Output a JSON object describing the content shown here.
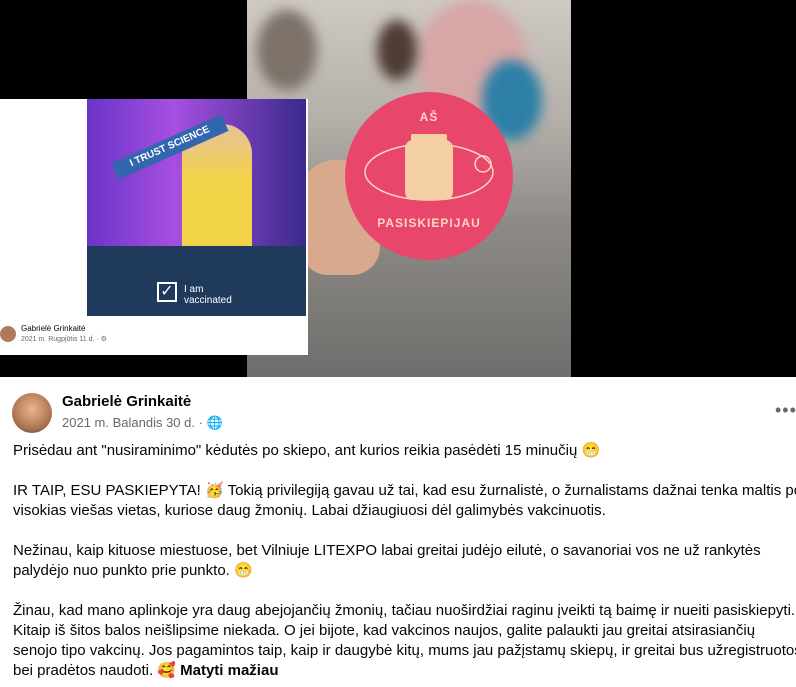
{
  "embed": {
    "banner_text": "I TRUST SCIENCE",
    "vaccinated_line1": "I am",
    "vaccinated_line2": "vaccinated",
    "author": "Gabrielė Grinkaitė",
    "date": "2021 m. Rugpjūtis 11 d. · ⚙"
  },
  "sticker": {
    "top": "AŠ",
    "bottom": "PASISKIEPIJAU"
  },
  "post": {
    "author": "Gabrielė Grinkaitė",
    "date": "2021 m. Balandis 30 d. · 🌐",
    "more_icon": "•••",
    "paragraphs": [
      "Prisėdau ant \"nusiraminimo\" kėdutės po skiepo, ant kurios reikia pasėdėti 15 minučių 😁",
      "IR TAIP, ESU PASKIEPYTA! 🥳 Tokią privilegiją gavau už tai, kad esu žurnalistė, o žurnalistams dažnai tenka maltis po visokias viešas vietas, kuriose daug žmonių. Labai džiaugiuosi dėl galimybės vakcinuotis.",
      "Nežinau, kaip kituose miestuose, bet Vilniuje LITEXPO labai greitai judėjo eilutė, o savanoriai vos ne už rankytės palydėjo nuo punkto prie punkto. 😁",
      "Žinau, kad mano aplinkoje yra daug abejojančių žmonių, tačiau nuoširdžiai raginu įveikti tą baimę ir nueiti pasiskiepyti. Kitaip iš šitos balos neišlipsime niekada. O jei bijote, kad vakcinos naujos, galite palaukti jau greitai atsirasiančių senojo tipo vakcinų. Jos pagamintos taip, kaip ir daugybė kitų, mums jau pažįstamų skiepų, ir greitai bus užregistruotos bei pradėtos naudoti. 🥰"
    ],
    "see_less": "Matyti mažiau"
  }
}
